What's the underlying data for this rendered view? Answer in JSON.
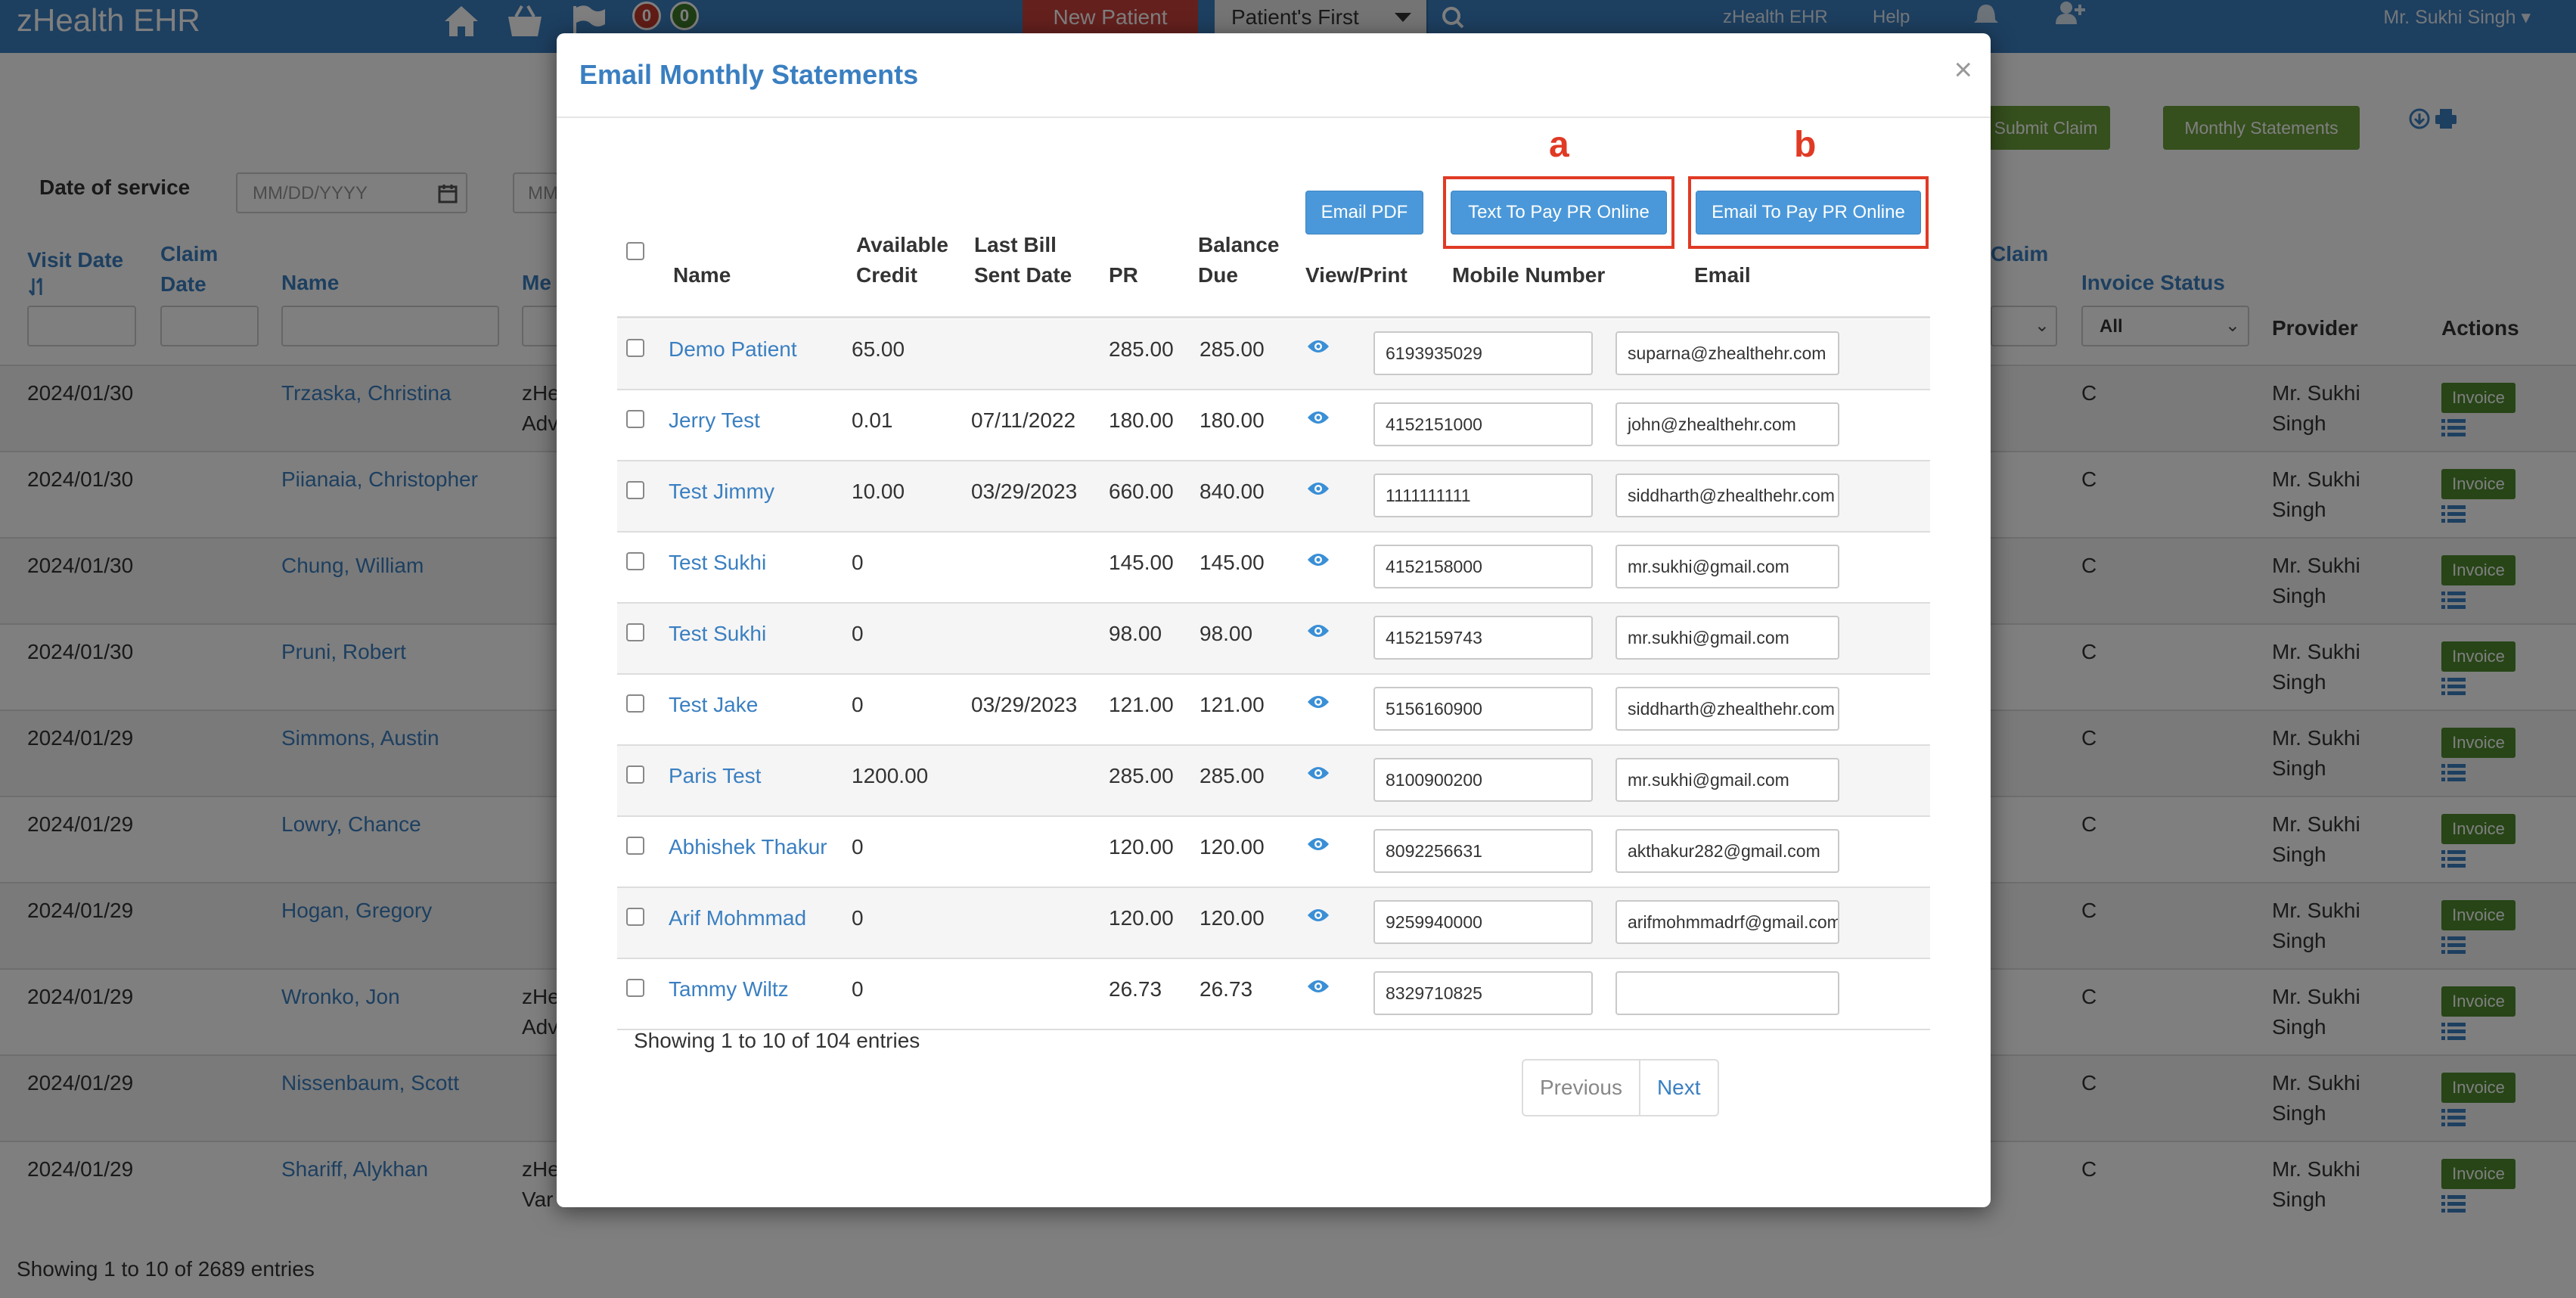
{
  "app": {
    "brand": "zHealth EHR",
    "badges": {
      "red": "0",
      "green": "0"
    },
    "new_patient": "New Patient",
    "search_select": "Patient's First",
    "links": {
      "zhealth": "zHealth EHR",
      "help": "Help"
    },
    "user": "Mr. Sukhi Singh"
  },
  "background": {
    "buttons": {
      "submit_claim": "Submit Claim",
      "monthly_statements": "Monthly Statements"
    },
    "filters": {
      "date_of_service_label": "Date of service",
      "date_placeholder": "MM/DD/YYYY",
      "date2_placeholder": "MM",
      "invoice_status_value": "All"
    },
    "headers": {
      "visit_date": "Visit Date",
      "claim_date": "Claim Date",
      "name": "Name",
      "me": "Me",
      "claim": "Claim",
      "invoice_status": "Invoice Status",
      "provider": "Provider",
      "actions": "Actions"
    },
    "rows": [
      {
        "date": "2024/01/30",
        "name": "Trzaska, Christina",
        "extra": "zHe\nAdv",
        "status": "C",
        "provider": "Mr. Sukhi\nSingh",
        "invoice": "Invoice"
      },
      {
        "date": "2024/01/30",
        "name": "Piianaia, Christopher",
        "extra": "",
        "status": "C",
        "provider": "Mr. Sukhi\nSingh",
        "invoice": "Invoice"
      },
      {
        "date": "2024/01/30",
        "name": "Chung, William",
        "extra": "",
        "status": "C",
        "provider": "Mr. Sukhi\nSingh",
        "invoice": "Invoice"
      },
      {
        "date": "2024/01/30",
        "name": "Pruni, Robert",
        "extra": "",
        "status": "C",
        "provider": "Mr. Sukhi\nSingh",
        "invoice": "Invoice"
      },
      {
        "date": "2024/01/29",
        "name": "Simmons, Austin",
        "extra": "",
        "status": "C",
        "provider": "Mr. Sukhi\nSingh",
        "invoice": "Invoice"
      },
      {
        "date": "2024/01/29",
        "name": "Lowry, Chance",
        "extra": "",
        "status": "C",
        "provider": "Mr. Sukhi\nSingh",
        "invoice": "Invoice"
      },
      {
        "date": "2024/01/29",
        "name": "Hogan, Gregory",
        "extra": "",
        "status": "C",
        "provider": "Mr. Sukhi\nSingh",
        "invoice": "Invoice"
      },
      {
        "date": "2024/01/29",
        "name": "Wronko, Jon",
        "extra": "zHe\nAdv",
        "status": "C",
        "provider": "Mr. Sukhi\nSingh",
        "invoice": "Invoice"
      },
      {
        "date": "2024/01/29",
        "name": "Nissenbaum, Scott",
        "extra": "",
        "status": "C",
        "provider": "Mr. Sukhi\nSingh",
        "invoice": "Invoice"
      },
      {
        "date": "2024/01/29",
        "name": "Shariff, Alykhan",
        "extra": "zHe\nVar",
        "status": "C",
        "provider": "Mr. Sukhi\nSingh",
        "invoice": "Invoice"
      }
    ],
    "footer": "Showing 1 to 10 of 2689 entries"
  },
  "modal": {
    "title": "Email Monthly Statements",
    "close": "×",
    "annotations": {
      "a": "a",
      "b": "b"
    },
    "buttons": {
      "email_pdf": "Email PDF",
      "text_to_pay": "Text To Pay PR Online",
      "email_to_pay": "Email To Pay PR Online"
    },
    "headers": {
      "name": "Name",
      "credit": "Available\nCredit",
      "last_bill": "Last Bill\nSent Date",
      "pr": "PR",
      "balance": "Balance\nDue",
      "view_print": "View/Print",
      "mobile": "Mobile Number",
      "email": "Email"
    },
    "rows": [
      {
        "name": "Demo Patient",
        "credit": "65.00",
        "last_bill": "",
        "pr": "285.00",
        "balance": "285.00",
        "mobile": "6193935029",
        "email": "suparna@zhealthehr.com"
      },
      {
        "name": "Jerry Test",
        "credit": "0.01",
        "last_bill": "07/11/2022",
        "pr": "180.00",
        "balance": "180.00",
        "mobile": "4152151000",
        "email": "john@zhealthehr.com"
      },
      {
        "name": "Test Jimmy",
        "credit": "10.00",
        "last_bill": "03/29/2023",
        "pr": "660.00",
        "balance": "840.00",
        "mobile": "1111111111",
        "email": "siddharth@zhealthehr.com"
      },
      {
        "name": "Test Sukhi",
        "credit": "0",
        "last_bill": "",
        "pr": "145.00",
        "balance": "145.00",
        "mobile": "4152158000",
        "email": "mr.sukhi@gmail.com"
      },
      {
        "name": "Test Sukhi",
        "credit": "0",
        "last_bill": "",
        "pr": "98.00",
        "balance": "98.00",
        "mobile": "4152159743",
        "email": "mr.sukhi@gmail.com"
      },
      {
        "name": "Test Jake",
        "credit": "0",
        "last_bill": "03/29/2023",
        "pr": "121.00",
        "balance": "121.00",
        "mobile": "5156160900",
        "email": "siddharth@zhealthehr.com"
      },
      {
        "name": "Paris Test",
        "credit": "1200.00",
        "last_bill": "",
        "pr": "285.00",
        "balance": "285.00",
        "mobile": "8100900200",
        "email": "mr.sukhi@gmail.com"
      },
      {
        "name": "Abhishek Thakur",
        "credit": "0",
        "last_bill": "",
        "pr": "120.00",
        "balance": "120.00",
        "mobile": "8092256631",
        "email": "akthakur282@gmail.com"
      },
      {
        "name": "Arif Mohmmad",
        "credit": "0",
        "last_bill": "",
        "pr": "120.00",
        "balance": "120.00",
        "mobile": "9259940000",
        "email": "arifmohmmadrf@gmail.com"
      },
      {
        "name": "Tammy Wiltz",
        "credit": "0",
        "last_bill": "",
        "pr": "26.73",
        "balance": "26.73",
        "mobile": "8329710825",
        "email": ""
      }
    ],
    "footer": "Showing 1 to 10 of 104 entries",
    "pagination": {
      "previous": "Previous",
      "next": "Next"
    }
  },
  "colors": {
    "nav": "#3a7fc1",
    "accent_red": "#e03a25",
    "button_blue": "#4a98d9",
    "invoice_green": "#4f8a2e"
  },
  "icons": [
    "home-icon",
    "basket-icon",
    "flag-icon",
    "search-icon",
    "user-plus-icon",
    "eye-icon",
    "printer-icon",
    "calendar-icon",
    "list-icon",
    "sort-icon"
  ]
}
